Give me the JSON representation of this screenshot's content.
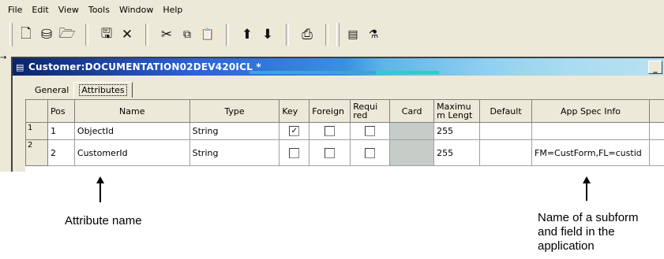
{
  "menu": [
    "File",
    "Edit",
    "View",
    "Tools",
    "Window",
    "Help"
  ],
  "toolbar_icons": [
    "new-document-icon",
    "open-icon",
    "open-folder-icon",
    "save-icon",
    "delete-icon",
    "cut-icon",
    "copy-icon",
    "paste-icon",
    "move-up-icon",
    "move-down-icon",
    "print-icon",
    "properties-icon",
    "wizard-icon"
  ],
  "window": {
    "title": "Customer:DOCUMENTATION02DEV420ICL *",
    "minimize_label": "_"
  },
  "tabs": [
    {
      "label": "General",
      "active": false
    },
    {
      "label": "Attributes",
      "active": true
    }
  ],
  "grid": {
    "columns": [
      "Pos",
      "Name",
      "Type",
      "Key",
      "Foreign",
      "Requi red",
      "Card",
      "Maximu m Lengt",
      "Default",
      "App Spec Info"
    ],
    "rows": [
      {
        "row": "1",
        "pos": "1",
        "name": "ObjectId",
        "type": "String",
        "key": true,
        "foreign": false,
        "required": false,
        "card": "",
        "max_length": "255",
        "default": "",
        "app_spec": ""
      },
      {
        "row": "2",
        "pos": "2",
        "name": "CustomerId",
        "type": "String",
        "key": false,
        "foreign": false,
        "required": false,
        "card": "",
        "max_length": "255",
        "default": "",
        "app_spec": "FM=CustForm,FL=custid"
      }
    ]
  },
  "annotations": {
    "attribute_name": "Attribute name",
    "subform_line1": "Name of a subform",
    "subform_line2": "and field in the",
    "subform_line3": "application"
  },
  "colors": {
    "window_bg": "#ece9d8",
    "title_start": "#0a246a",
    "title_end": "#b8e2f2",
    "card_cell": "#c6ccc8"
  }
}
